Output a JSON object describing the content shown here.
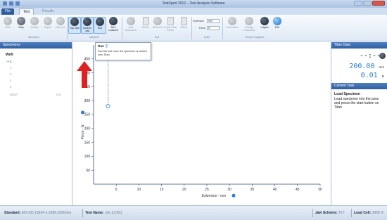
{
  "window": {
    "title": "TestXpert 2012 – Test Analysis Software"
  },
  "tabs": [
    {
      "label": "File"
    },
    {
      "label": "Test"
    },
    {
      "label": "Results"
    }
  ],
  "ribbon": {
    "buttons": [
      {
        "label": "Start"
      },
      {
        "label": "Stop"
      },
      {
        "label": "Accept"
      },
      {
        "label": "Reject"
      },
      {
        "label": "Observe"
      },
      {
        "label": "Top Jaw"
      },
      {
        "label": "Bottom Jaw"
      },
      {
        "label": "Run"
      },
      {
        "label": "Tare Loadcell"
      },
      {
        "label": "Add Specimen"
      },
      {
        "label": "Delete"
      },
      {
        "label": "Select All"
      },
      {
        "label": "Show Data Points"
      },
      {
        "label": "Offset"
      },
      {
        "label": "Favourites"
      },
      {
        "label": "Change Password"
      },
      {
        "label": "Logout"
      },
      {
        "label": "Exit"
      }
    ],
    "groups": [
      {
        "label": "Specimen"
      },
      {
        "label": "Machine"
      },
      {
        "label": "Test"
      },
      {
        "label": "Units"
      },
      {
        "label": "Service Engineer"
      }
    ],
    "units": {
      "extension_label": "Extension",
      "extension_value": "mm",
      "force_label": "Force",
      "force_value": "N"
    }
  },
  "specimens": {
    "header": "Specimens",
    "group": "Weft",
    "rows": [
      "1",
      "2",
      "3",
      "4",
      "5"
    ],
    "mean_label": "Mean",
    "mean_value": "n/a"
  },
  "tooltip": {
    "title": "Run",
    "text": "Run the test once the specimen is loaded onto Titan."
  },
  "chart_data": {
    "type": "line",
    "xlabel": "Extension - mm",
    "ylabel": "Force - N",
    "xlim": [
      0,
      50
    ],
    "ylim": [
      0,
      500
    ],
    "x_ticks": [
      5,
      10,
      15,
      20,
      25,
      30,
      35,
      40,
      45,
      50
    ],
    "y_ticks": [
      50,
      100,
      150,
      200,
      250,
      300,
      350,
      400,
      450
    ],
    "grid": false,
    "force_gauge_range": [
      280,
      490
    ]
  },
  "titan": {
    "header": "Titan Data",
    "time": "--:--",
    "extension": "200.00",
    "extension_unit": "mm",
    "force": "0.01",
    "force_unit": "N"
  },
  "task": {
    "header": "Current Task",
    "title": "Load Specimen",
    "text": "Load specimen into the jaws and press the start button on Titan"
  },
  "status": {
    "standard_label": "Standard:",
    "standard_value": "EN ISO 13934-1:1999 (200mm)",
    "test_name_label": "Test Name:",
    "test_name_value": "Job 12.051",
    "jaw_scheme_label": "Jaw Scheme:",
    "jaw_scheme_value": "T17",
    "load_cell_label": "Load Cell:",
    "load_cell_value": "3000 N"
  },
  "colors": {
    "accent": "#2a7ad6",
    "header": "#2f5f9e",
    "arrow": "#e02020"
  }
}
